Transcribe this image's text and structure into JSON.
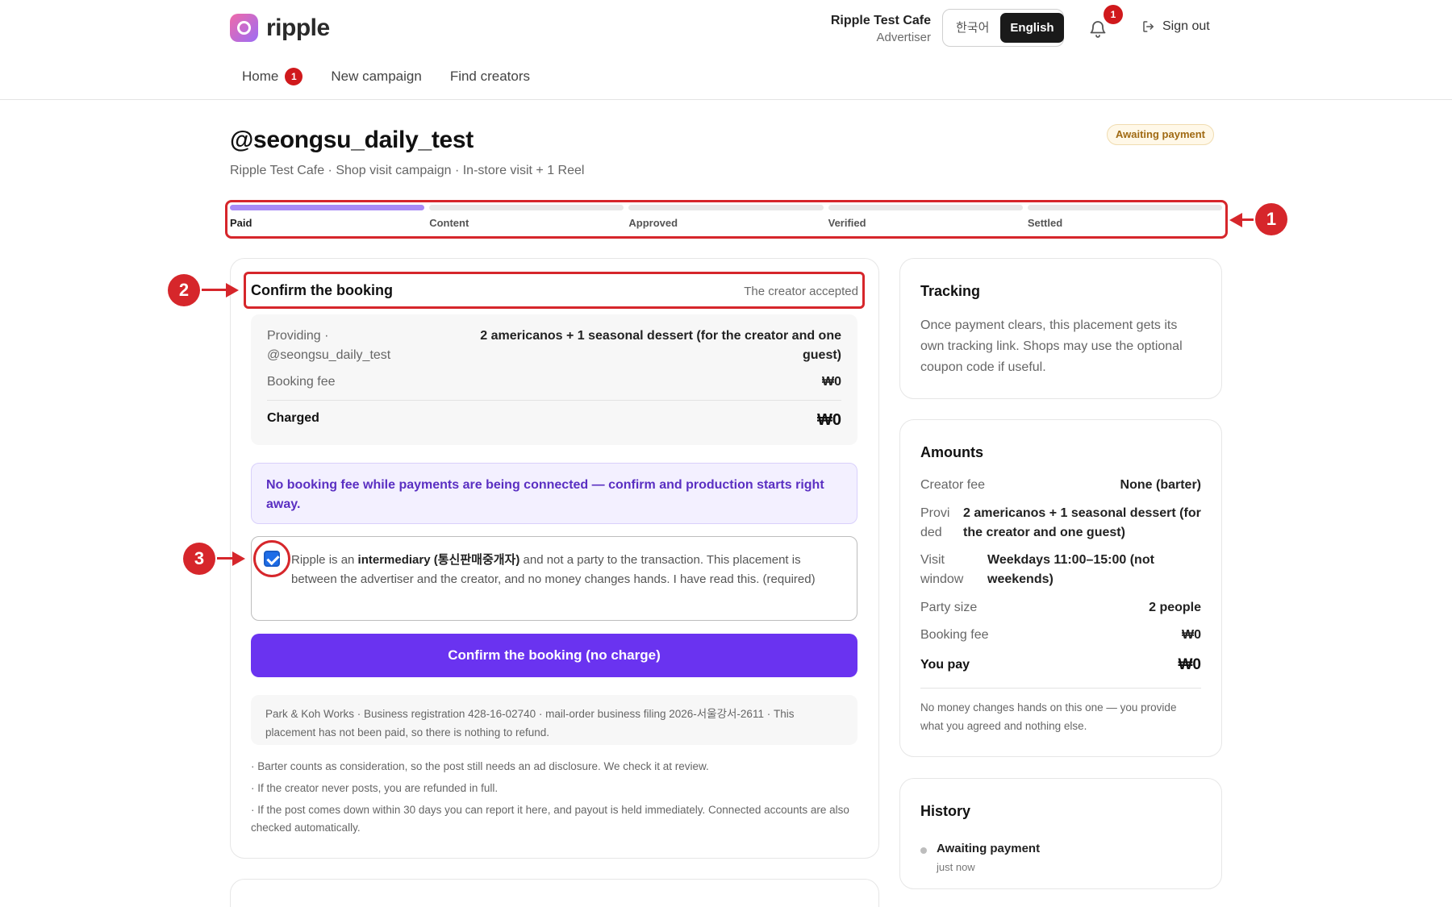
{
  "header": {
    "logo_text": "ripple",
    "account_name": "Ripple Test Cafe",
    "account_role": "Advertiser",
    "languages": [
      "한국어",
      "English"
    ],
    "active_language": "English",
    "notification_count": "1",
    "sign_out_label": "Sign out"
  },
  "nav": {
    "items": [
      {
        "label": "Home",
        "badge": "1"
      },
      {
        "label": "New campaign"
      },
      {
        "label": "Find creators"
      }
    ]
  },
  "page": {
    "title": "@seongsu_daily_test",
    "subtitle": "Ripple Test Cafe · Shop visit campaign · In-store visit + 1 Reel",
    "status": "Awaiting payment"
  },
  "progress": {
    "steps": [
      "Paid",
      "Content",
      "Approved",
      "Verified",
      "Settled"
    ],
    "completed": 1
  },
  "callouts": [
    "1",
    "2",
    "3"
  ],
  "booking": {
    "title": "Confirm the booking",
    "meta": "The creator accepted",
    "providing_label": "Providing · @seongsu_daily_test",
    "providing_value": "2 americanos + 1 seasonal dessert (for the creator and one guest)",
    "fee_label": "Booking fee",
    "fee_value": "₩0",
    "charged_label": "Charged",
    "charged_value": "₩0",
    "banner": "No booking fee while payments are being connected — confirm and production starts right away.",
    "consent_pre": "Ripple is an ",
    "consent_bold": "intermediary (통신판매중개자)",
    "consent_post": " and not a party to the transaction. This placement is between the advertiser and the creator, and no money changes hands. I have read this. (required)",
    "consent_checked": true,
    "confirm_label": "Confirm the booking (no charge)",
    "legal": "Park & Koh Works · Business registration 428-16-02740 · mail-order business filing 2026-서울강서-2611 · This placement has not been paid, so there is nothing to refund.",
    "notes": [
      "· Barter counts as consideration, so the post still needs an ad disclosure. We check it at review.",
      "· If the creator never posts, you are refunded in full.",
      "· If the post comes down within 30 days you can report it here, and payout is held immediately. Connected accounts are also checked automatically."
    ]
  },
  "tracking": {
    "title": "Tracking",
    "text": "Once payment clears, this placement gets its own tracking link. Shops may use the optional coupon code if useful."
  },
  "amounts": {
    "title": "Amounts",
    "creator_fee_label": "Creator fee",
    "creator_fee_value": "None (barter)",
    "provided_label": "Provided",
    "provided_value": "2 americanos + 1 seasonal dessert (for the creator and one guest)",
    "visit_label": "Visit window",
    "visit_value": "Weekdays 11:00–15:00 (not weekends)",
    "party_label": "Party size",
    "party_value": "2 people",
    "fee_label": "Booking fee",
    "fee_value": "₩0",
    "pay_label": "You pay",
    "pay_value": "₩0",
    "note": "No money changes hands on this one — you provide what you agreed and nothing else."
  },
  "history": {
    "title": "History",
    "event": "Awaiting payment",
    "time": "just now"
  },
  "colors": {
    "accent": "#6a33f0",
    "annotation_red": "#d6262b",
    "progress_done": "#a88af5",
    "status_badge": "#a06a13"
  }
}
